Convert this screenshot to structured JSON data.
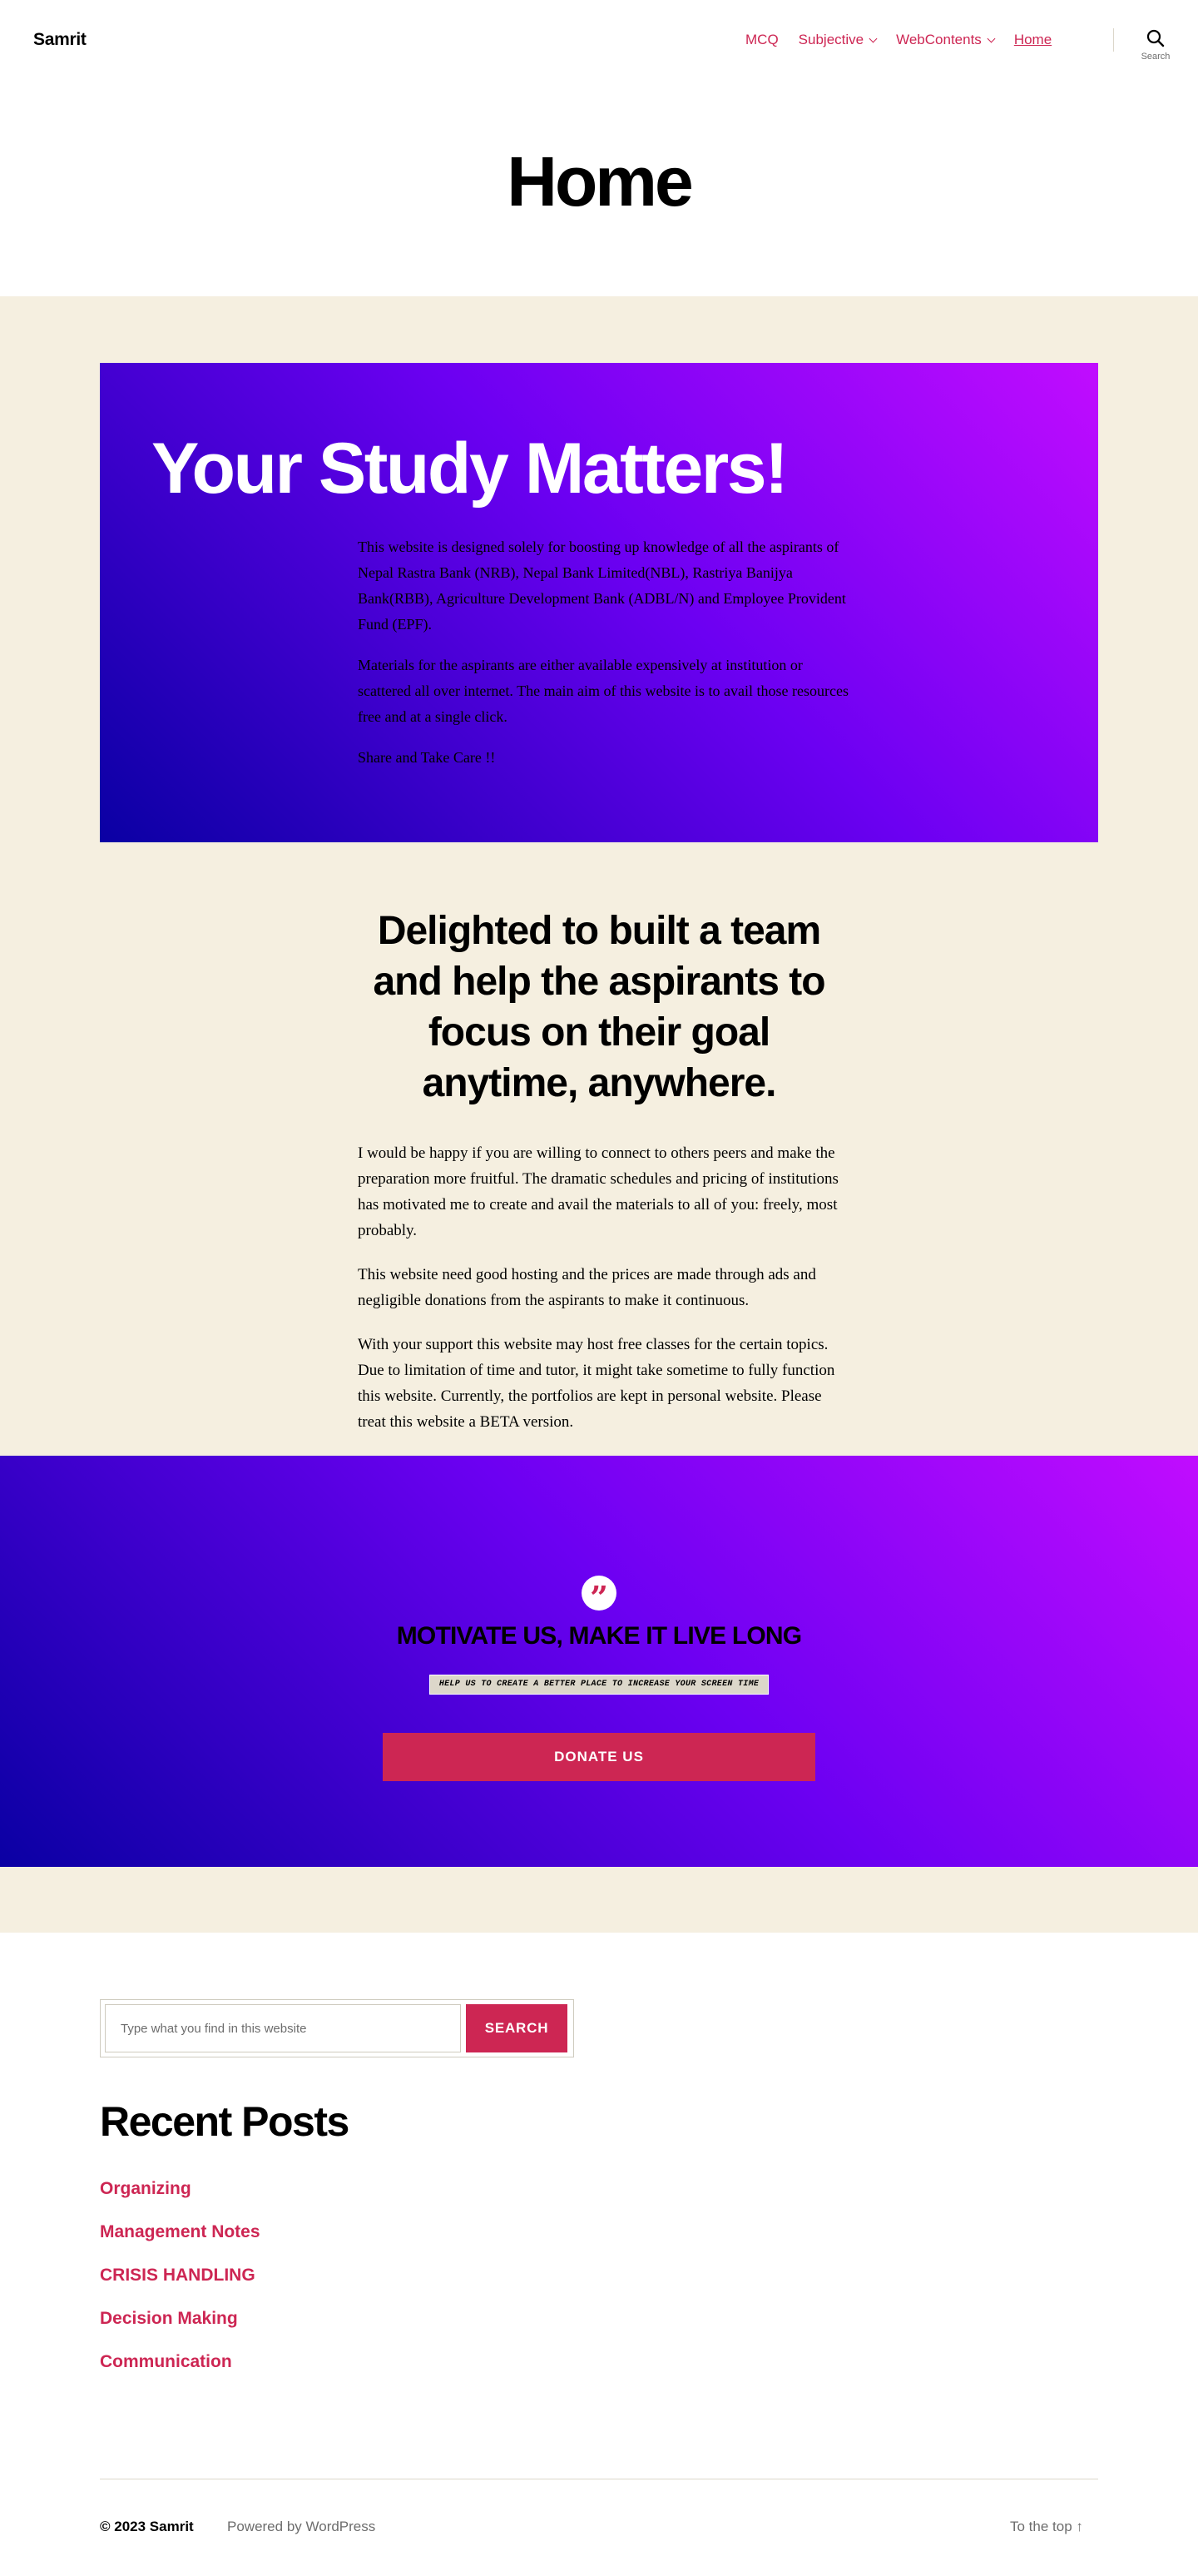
{
  "header": {
    "site_title": "Samrit",
    "nav": [
      {
        "label": "MCQ",
        "has_dropdown": false,
        "current": false
      },
      {
        "label": "Subjective",
        "has_dropdown": true,
        "current": false
      },
      {
        "label": "WebContents",
        "has_dropdown": true,
        "current": false
      },
      {
        "label": "Home",
        "has_dropdown": false,
        "current": true
      }
    ],
    "search_label": "Search",
    "search_icon": "search-icon"
  },
  "page": {
    "title": "Home"
  },
  "hero": {
    "title": "Your Study Matters!",
    "paragraphs": [
      "This website is designed solely for boosting up knowledge of all the aspirants of Nepal Rastra Bank (NRB), Nepal Bank Limited(NBL), Rastriya Banijya Bank(RBB), Agriculture Development Bank (ADBL/N) and Employee Provident Fund (EPF).",
      "Materials for the aspirants are either available expensively at institution or scattered all over internet. The main aim of this website is to avail those resources free and at a single click.",
      "Share and Take Care !!"
    ],
    "gradient_colors": [
      "#0a00a3",
      "#6c00f2",
      "#c10cff"
    ]
  },
  "team": {
    "title": "Delighted to built a team and help the aspirants to focus on their goal anytime, anywhere.",
    "paragraphs": [
      "I would be happy if you are willing to connect to others peers and make the preparation more fruitful. The dramatic schedules and pricing of institutions has motivated me to create and avail the materials to all of you: freely, most probably.",
      "This website need good hosting and the prices are made through ads and negligible donations from the aspirants to make it continuous.",
      "With your support this website may host free classes for the certain topics. Due to limitation of time and tutor, it might take sometime to fully function this website. Currently, the portfolios are kept in personal website. Please treat this website a BETA version."
    ]
  },
  "donate": {
    "quote_icon": "quote-icon",
    "quote_glyph": "”",
    "title": "MOTIVATE US, MAKE IT LIVE LONG",
    "subtitle": "HELP US TO CREATE A BETTER PLACE TO INCREASE YOUR SCREEN TIME",
    "button_label": "DONATE US"
  },
  "widgets": {
    "search_placeholder": "Type what you find in this website",
    "search_value": "",
    "search_button": "SEARCH",
    "recent_posts_title": "Recent Posts",
    "recent_posts": [
      "Organizing",
      "Management Notes",
      "CRISIS HANDLING",
      "Decision Making",
      "Communication"
    ]
  },
  "footer": {
    "copyright": "© 2023 Samrit",
    "powered_by": "Powered by WordPress",
    "to_top": "To the top ↑"
  },
  "colors": {
    "accent": "#cd2653",
    "background_beige": "#f5efe0",
    "muted_text": "#6d6d6d"
  }
}
